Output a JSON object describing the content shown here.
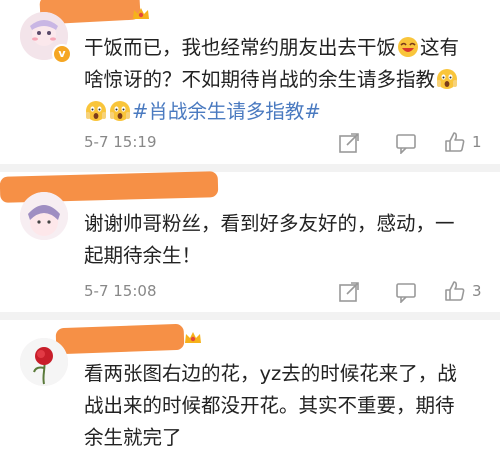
{
  "comments": [
    {
      "text_lines": [
        "干饭而已，我也经常约朋友出去干饭",
        "这有",
        "啥惊讶的？不如期待肖战的余生请多指教",
        ""
      ],
      "hashtag": "#肖战余生请多指教#",
      "time": "5-7 15:19",
      "likes": "1",
      "badge": "v"
    },
    {
      "text_lines": [
        "谢谢帅哥粉丝，看到好多友好的，感动，一",
        "起期待余生！"
      ],
      "time": "5-7 15:08",
      "likes": "3"
    },
    {
      "text_lines": [
        "看两张图右边的花，yz去的时候花来了，战",
        "战出来的时候都没开花。其实不重要，期待",
        "余生就完了"
      ]
    }
  ],
  "colors": {
    "scribble": "#f58a3c",
    "hashtag": "#4a7ac0",
    "time": "#888888",
    "separator": "#f2f2f2"
  },
  "icons": [
    "share-icon",
    "comment-icon",
    "like-icon",
    "v-badge-icon",
    "crown-icon",
    "scream-emoji",
    "laugh-emoji"
  ]
}
